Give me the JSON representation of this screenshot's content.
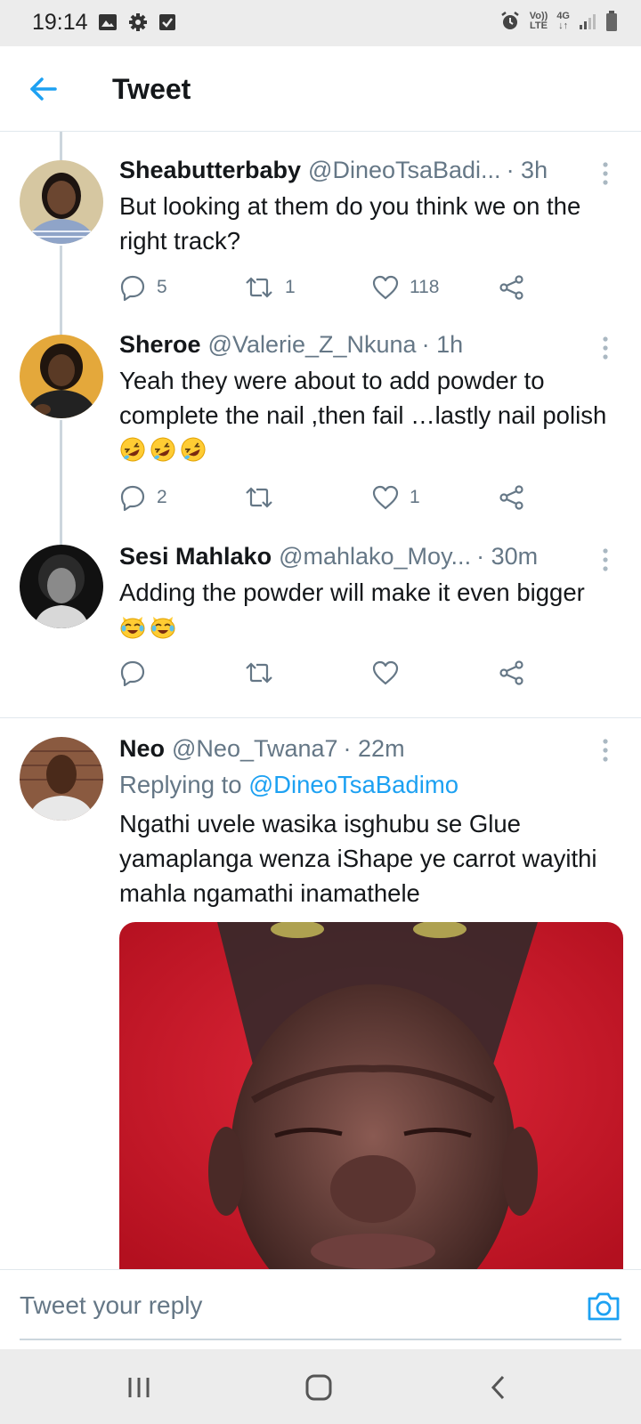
{
  "status_bar": {
    "time": "19:14",
    "left_icons": [
      "gallery-icon",
      "gear-icon",
      "checkbox-icon"
    ],
    "volte_top": "Vo))",
    "volte_bottom": "LTE",
    "network": "4G",
    "right_icons": [
      "alarm-icon",
      "volte-icon",
      "signal-icon",
      "battery-icon"
    ]
  },
  "header": {
    "title": "Tweet",
    "back_icon": "arrow-left-icon"
  },
  "tweets": [
    {
      "name": "Sheabutterbaby",
      "handle": "@DineoTsaBadi...",
      "time": "· 3h",
      "text": "But looking at them do you think we on the right track?",
      "emoji": [],
      "replies": "5",
      "retweets": "1",
      "likes": "118"
    },
    {
      "name": "Sheroe",
      "handle": "@Valerie_Z_Nkuna",
      "time": "· 1h",
      "text": "Yeah they were about to add powder to complete the nail ,then fail …lastly nail polish",
      "emoji": [
        "rofl",
        "rofl",
        "rofl"
      ],
      "replies": "2",
      "retweets": "",
      "likes": "1"
    },
    {
      "name": "Sesi Mahlako",
      "handle": "@mahlako_Moy...",
      "time": "· 30m",
      "text": "Adding the powder will make it even bigger",
      "emoji": [
        "cat-joy",
        "cat-joy"
      ],
      "replies": "",
      "retweets": "",
      "likes": ""
    },
    {
      "name": "Neo",
      "handle": "@Neo_Twana7",
      "time": "· 22m",
      "replying_prefix": "Replying to ",
      "replying_handle": "@DineoTsaBadimo",
      "text": "Ngathi uvele wasika isghubu se Glue yamaplanga  wenza iShape ye carrot wayithi mahla ngamathi inamathele"
    }
  ],
  "reply_bar": {
    "placeholder": "Tweet your reply",
    "camera_icon": "camera-icon"
  },
  "nav_bar": {
    "icons": [
      "recent-apps-icon",
      "home-icon",
      "back-icon"
    ]
  },
  "colors": {
    "accent": "#1da1f2",
    "text": "#14171a",
    "secondary": "#657786",
    "divider": "#e1e8ed",
    "system_bar": "#ececec"
  }
}
